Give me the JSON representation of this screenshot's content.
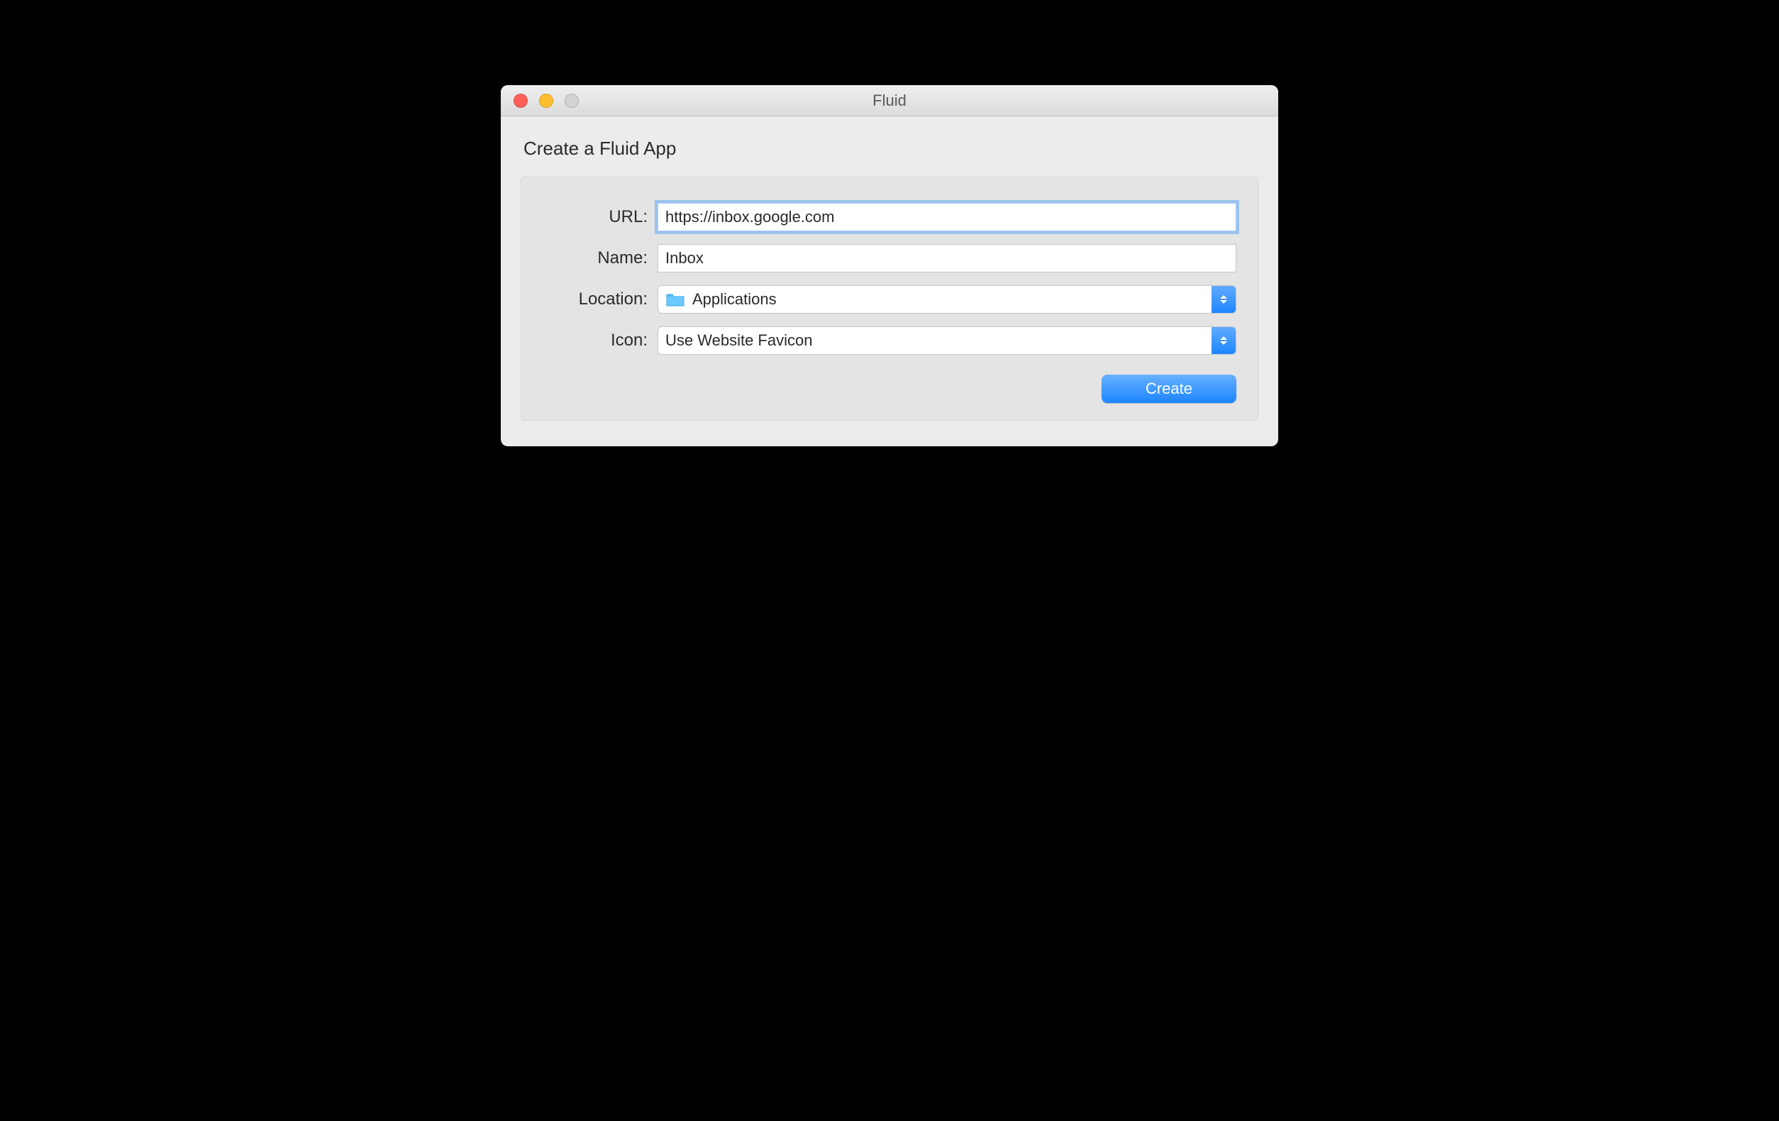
{
  "window": {
    "title": "Fluid"
  },
  "heading": "Create a Fluid App",
  "form": {
    "url": {
      "label": "URL:",
      "value": "https://inbox.google.com"
    },
    "name": {
      "label": "Name:",
      "value": "Inbox"
    },
    "location": {
      "label": "Location:",
      "value": "Applications"
    },
    "icon": {
      "label": "Icon:",
      "value": "Use Website Favicon"
    }
  },
  "buttons": {
    "create": "Create"
  }
}
